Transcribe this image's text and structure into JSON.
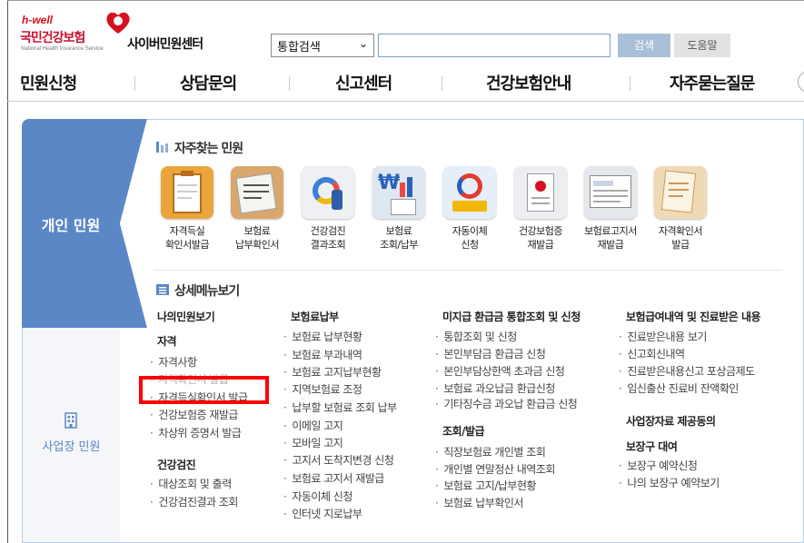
{
  "header": {
    "logo_hwell": "h-well",
    "logo_name": "국민건강보험",
    "logo_english": "National Health Insurance Service",
    "site_title": "사이버민원센터",
    "search_select_value": "통합검색",
    "search_button": "검색",
    "help_button": "도움말"
  },
  "nav": {
    "items": [
      "민원신청",
      "상담문의",
      "신고센터",
      "건강보험안내",
      "자주묻는질문"
    ]
  },
  "tabs": {
    "personal": "개인 민원",
    "business": "사업장 민원"
  },
  "quick": {
    "title": "자주찾는 민원",
    "items": [
      {
        "label": "자격득실\n확인서발급",
        "icon": "clipboard-icon"
      },
      {
        "label": "보험료\n납부확인서",
        "icon": "receipt-icon"
      },
      {
        "label": "건강검진\n결과조회",
        "icon": "checkup-icon"
      },
      {
        "label": "보험료\n조회/납부",
        "icon": "payment-icon"
      },
      {
        "label": "자동이체\n신청",
        "icon": "auto-transfer-icon"
      },
      {
        "label": "건강보험증\n재발급",
        "icon": "insurance-card-icon"
      },
      {
        "label": "보험료고지서\n재발급",
        "icon": "bill-icon"
      },
      {
        "label": "자격확인서\n발급",
        "icon": "certificate-icon"
      }
    ]
  },
  "detail": {
    "title": "상세메뉴보기",
    "col1": {
      "head": "나의민원보기",
      "group1": "자격",
      "group1_items": [
        "자격사항",
        "자격확인서 발급",
        "자격득실확인서 발급",
        "건강보험증 재발급",
        "차상위 증명서 발급"
      ],
      "group2": "건강검진",
      "group2_items": [
        "대상조회 및 출력",
        "건강검진결과 조회"
      ]
    },
    "col2": {
      "head": "보험료납부",
      "items": [
        "보험료 납부현황",
        "보험료 부과내역",
        "보험료 고지납부현황",
        "지역보험료 조정",
        "납부할 보험료 조회 납부",
        "이메일 고지",
        "모바일 고지",
        "고지서 도착지변경 신청",
        "보험료 고지서 재발급",
        "자동이체 신청",
        "인터넷 지로납부"
      ]
    },
    "col3": {
      "head": "미지급 환급금 통합조회 및 신청",
      "items": [
        "통합조회 및 신청",
        "본인부담금 환급금 신청",
        "본인부담상한액 초과금 신청",
        "보험료 과오납금 환급신청",
        "기타징수금 과오납 환급금 신청"
      ],
      "head2": "조회/발급",
      "items2": [
        "직장보험료 개인별 조회",
        "개인별 연말정산 내역조회",
        "보험료 고지/납부현황",
        "보험료 납부확인서"
      ]
    },
    "col4": {
      "head": "보험급여내역 및 진료받은 내용",
      "items": [
        "진료받은내용 보기",
        "신고회신내역",
        "진료받은내용신고 포상금제도",
        "임신출산 진료비 잔액확인"
      ],
      "head2": "사업장자료 제공동의",
      "head3": "보장구 대여",
      "items3": [
        "보장구 예약신청",
        "나의 보장구 예약보기"
      ]
    }
  },
  "colors": {
    "brand_red": "#c8102e",
    "tab_blue": "#5b87c6",
    "highlight": "#ff0000"
  }
}
